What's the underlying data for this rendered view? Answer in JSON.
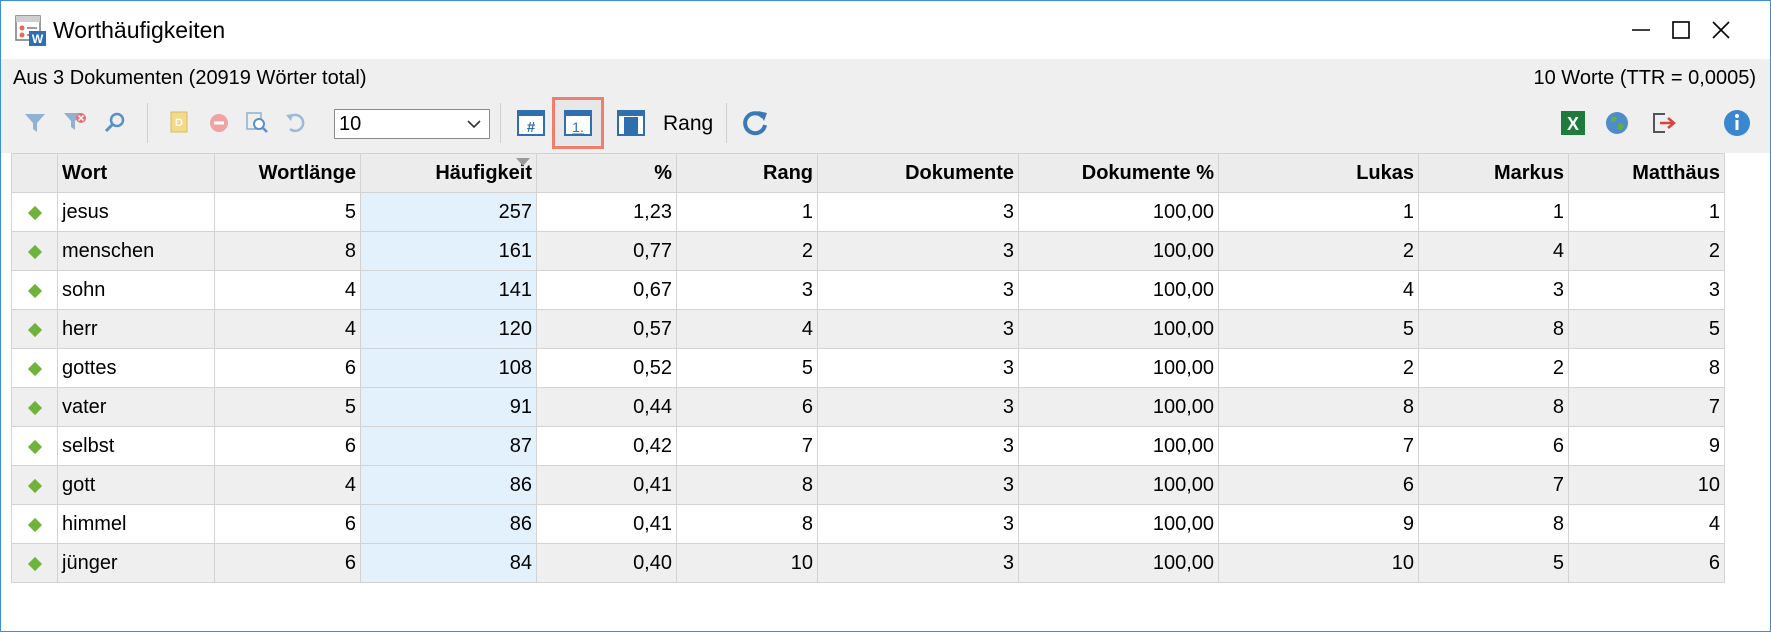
{
  "window": {
    "title": "Worthäufigkeiten"
  },
  "info": {
    "left": "Aus 3 Dokumenten (20919 Wörter total)",
    "right": "10 Worte (TTR = 0,0005)"
  },
  "toolbar": {
    "count_value": "10",
    "rank_label": "Rang",
    "icons": [
      "filter-icon",
      "filter-remove-icon",
      "search-icon",
      "document-icon",
      "stop-icon",
      "zoom-icon",
      "undo-icon",
      "hash-column-icon",
      "rank-column-icon",
      "column-icon",
      "refresh-icon",
      "excel-icon",
      "globe-icon",
      "export-icon",
      "info-icon"
    ]
  },
  "table": {
    "columns": [
      "Wort",
      "Wortlänge",
      "Häufigkeit",
      "%",
      "Rang",
      "Dokumente",
      "Dokumente %",
      "Lukas",
      "Markus",
      "Matthäus"
    ],
    "sorted_column": "Häufigkeit",
    "rows": [
      [
        "jesus",
        "5",
        "257",
        "1,23",
        "1",
        "3",
        "100,00",
        "1",
        "1",
        "1"
      ],
      [
        "menschen",
        "8",
        "161",
        "0,77",
        "2",
        "3",
        "100,00",
        "2",
        "4",
        "2"
      ],
      [
        "sohn",
        "4",
        "141",
        "0,67",
        "3",
        "3",
        "100,00",
        "4",
        "3",
        "3"
      ],
      [
        "herr",
        "4",
        "120",
        "0,57",
        "4",
        "3",
        "100,00",
        "5",
        "8",
        "5"
      ],
      [
        "gottes",
        "6",
        "108",
        "0,52",
        "5",
        "3",
        "100,00",
        "2",
        "2",
        "8"
      ],
      [
        "vater",
        "5",
        "91",
        "0,44",
        "6",
        "3",
        "100,00",
        "8",
        "8",
        "7"
      ],
      [
        "selbst",
        "6",
        "87",
        "0,42",
        "7",
        "3",
        "100,00",
        "7",
        "6",
        "9"
      ],
      [
        "gott",
        "4",
        "86",
        "0,41",
        "8",
        "3",
        "100,00",
        "6",
        "7",
        "10"
      ],
      [
        "himmel",
        "6",
        "86",
        "0,41",
        "8",
        "3",
        "100,00",
        "9",
        "8",
        "4"
      ],
      [
        "jünger",
        "6",
        "84",
        "0,40",
        "10",
        "3",
        "100,00",
        "10",
        "5",
        "6"
      ]
    ]
  },
  "colors": {
    "accent_border": "#3c8fd6",
    "active_highlight": "#ef7f6d",
    "marker_green": "#6fb33a",
    "sorted_column_bg": "#e3f1fc"
  }
}
